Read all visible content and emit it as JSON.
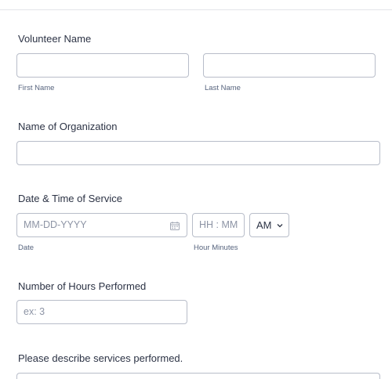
{
  "form": {
    "volunteer_name": {
      "label": "Volunteer Name",
      "first_sublabel": "First Name",
      "last_sublabel": "Last Name",
      "first_value": "",
      "last_value": ""
    },
    "organization": {
      "label": "Name of Organization",
      "value": ""
    },
    "service_datetime": {
      "label": "Date & Time of Service",
      "date_placeholder": "MM-DD-YYYY",
      "date_sublabel": "Date",
      "time_placeholder": "HH : MM",
      "time_sublabel": "Hour Minutes",
      "ampm_value": "AM",
      "date_icon": "calendar-icon",
      "ampm_icon": "chevron-down-icon"
    },
    "hours": {
      "label": "Number of Hours Performed",
      "placeholder": "ex: 3"
    },
    "services": {
      "label": "Please describe services performed."
    }
  }
}
